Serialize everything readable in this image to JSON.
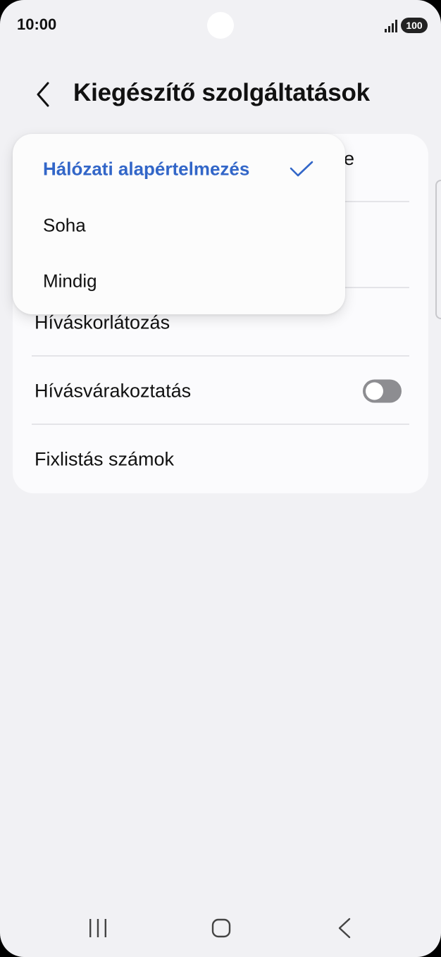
{
  "status_bar": {
    "time": "10:00",
    "battery": "100",
    "icons": [
      "signal-icon",
      "camera-hole"
    ]
  },
  "header": {
    "title": "Kiegészítő szolgáltatások",
    "back_icon": "chevron-left-icon"
  },
  "settings": {
    "rows": [
      {
        "label": "",
        "partial_visible_text": "e"
      },
      {
        "label": ""
      },
      {
        "label": "Híváskorlátozás"
      },
      {
        "label": "Hívásvárakoztatás",
        "toggle": false
      },
      {
        "label": "Fixlistás számok"
      }
    ]
  },
  "dropdown": {
    "options": [
      {
        "label": "Hálózati alapértelmezés",
        "selected": true
      },
      {
        "label": "Soha",
        "selected": false
      },
      {
        "label": "Mindig",
        "selected": false
      }
    ],
    "check_icon": "check-icon"
  },
  "nav_bar": {
    "icons": [
      "recents-icon",
      "home-icon",
      "back-icon"
    ]
  },
  "colors": {
    "accent": "#3266c8",
    "background": "#f1f1f4",
    "card": "#fbfbfd",
    "toggle_off": "#8d8d91"
  }
}
